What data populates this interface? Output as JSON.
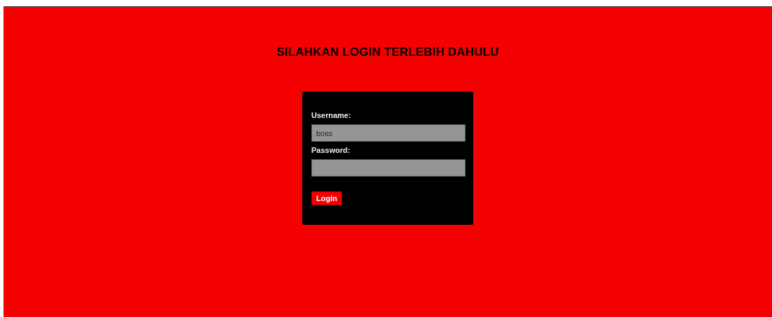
{
  "heading": "SILAHKAN LOGIN TERLEBIH DAHULU",
  "form": {
    "fields": [
      {
        "label": "Username:",
        "value": "boss"
      },
      {
        "label": "Password:"
      }
    ],
    "button": "Login"
  }
}
